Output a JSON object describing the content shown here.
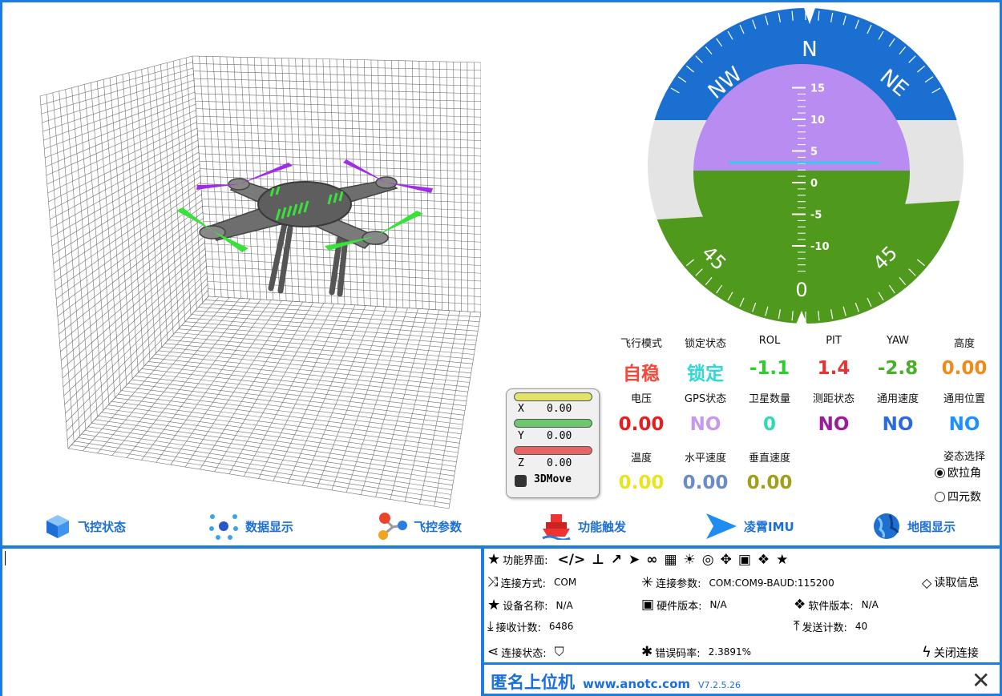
{
  "colors": {
    "accent": "#1e7be0",
    "horizon_sky": "#b98cf2",
    "horizon_ground": "#4f9a1c",
    "compass_blue": "#1a6fd0",
    "prop_green": "#38e23a",
    "prop_purple": "#a02ee8"
  },
  "horizon": {
    "compass_labels": [
      "N",
      "NW",
      "NE"
    ],
    "roll_labels": [
      "45",
      "45",
      "0"
    ],
    "pitch_ticks": [
      "15",
      "10",
      "5",
      "0",
      "-5",
      "-10"
    ]
  },
  "telemetry": {
    "row1": [
      {
        "label": "飞行模式",
        "value": "自稳",
        "color": "#f04a3a"
      },
      {
        "label": "锁定状态",
        "value": "锁定",
        "color": "#2fd8d8"
      },
      {
        "label": "ROL",
        "value": "-1.1",
        "color": "#2bcf2b"
      },
      {
        "label": "PIT",
        "value": "1.4",
        "color": "#e83333"
      },
      {
        "label": "YAW",
        "value": "-2.8",
        "color": "#4aae2a"
      },
      {
        "label": "高度",
        "value": "0.00",
        "color": "#f08a1a"
      }
    ],
    "row2": [
      {
        "label": "电压",
        "value": "0.00",
        "color": "#e81e1e"
      },
      {
        "label": "GPS状态",
        "value": "NO",
        "color": "#c49af0"
      },
      {
        "label": "卫星数量",
        "value": "0",
        "color": "#2fd8b8"
      },
      {
        "label": "测距状态",
        "value": "NO",
        "color": "#9c1a9c"
      },
      {
        "label": "通用速度",
        "value": "NO",
        "color": "#2a6ae0"
      },
      {
        "label": "通用位置",
        "value": "NO",
        "color": "#1e90ff"
      }
    ],
    "row3": [
      {
        "label": "温度",
        "value": "0.00",
        "color": "#e6e61e"
      },
      {
        "label": "水平速度",
        "value": "0.00",
        "color": "#6a8ac8"
      },
      {
        "label": "垂直速度",
        "value": "0.00",
        "color": "#a0a01a"
      }
    ],
    "attitude_select_label": "姿态选择",
    "attitude_options": [
      {
        "label": "欧拉角",
        "selected": true
      },
      {
        "label": "四元数",
        "selected": false
      }
    ]
  },
  "xyz": {
    "x_label": "X",
    "x_value": "0.00",
    "x_color": "#e3e36a",
    "y_label": "Y",
    "y_value": "0.00",
    "y_color": "#6dc86d",
    "z_label": "Z",
    "z_value": "0.00",
    "z_color": "#e56464",
    "move_label": "3DMove"
  },
  "nav": [
    {
      "label": "飞控状态",
      "icon": "cube-icon"
    },
    {
      "label": "数据显示",
      "icon": "network-icon"
    },
    {
      "label": "飞控参数",
      "icon": "molecule-icon"
    },
    {
      "label": "功能触发",
      "icon": "ship-icon"
    },
    {
      "label": "凌霄IMU",
      "icon": "arrow-icon"
    },
    {
      "label": "地图显示",
      "icon": "globe-icon"
    }
  ],
  "info": {
    "function_label": "功能界面:",
    "connect_method_label": "连接方式:",
    "connect_method_value": "COM",
    "connect_params_label": "连接参数:",
    "connect_params_value": "COM:COM9-BAUD:115200",
    "read_info_label": "读取信息",
    "device_name_label": "设备名称:",
    "device_name_value": "N/A",
    "hw_version_label": "硬件版本:",
    "hw_version_value": "N/A",
    "sw_version_label": "软件版本:",
    "sw_version_value": "N/A",
    "rx_count_label": "接收计数:",
    "rx_count_value": "6486",
    "tx_count_label": "发送计数:",
    "tx_count_value": "40",
    "conn_status_label": "连接状态:",
    "error_rate_label": "错误码率:",
    "error_rate_value": "2.3891%",
    "close_conn_label": "关闭连接"
  },
  "brand": {
    "name": "匿名上位机",
    "url": "www.anotc.com",
    "version": "V7.2.5.26"
  }
}
